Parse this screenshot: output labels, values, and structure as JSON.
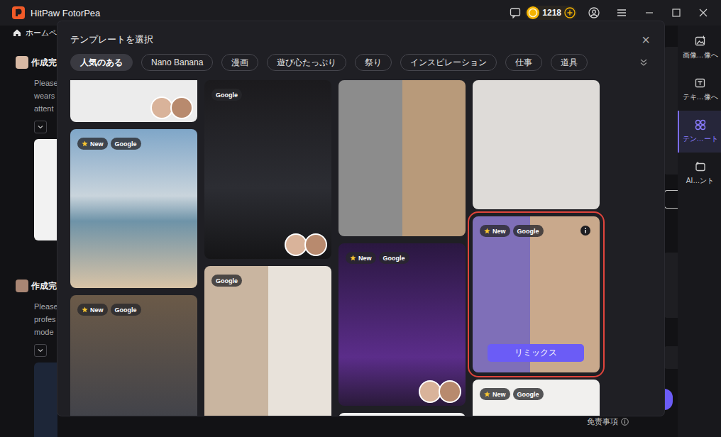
{
  "window": {
    "title": "HitPaw FotorPea"
  },
  "title_bar": {
    "coins": "1218"
  },
  "home": {
    "label": "ホームペ"
  },
  "history": [
    {
      "title": "作成完",
      "lines": [
        "Please",
        "wears",
        "attent"
      ]
    },
    {
      "title": "作成完",
      "lines": [
        "Please",
        "profes",
        "mode"
      ]
    }
  ],
  "sidebar": {
    "items": [
      {
        "label": "画像…像へ",
        "selected": false
      },
      {
        "label": "テキ…像へ",
        "selected": false
      },
      {
        "label": "テン…ート",
        "selected": true
      },
      {
        "label": "AI…ント",
        "selected": false
      }
    ]
  },
  "disclaimer": "免责事項",
  "modal": {
    "title": "テンプレートを選択",
    "close": "×",
    "tabs": [
      {
        "label": "人気のある",
        "selected": true
      },
      {
        "label": "Nano Banana",
        "selected": false
      },
      {
        "label": "漫画",
        "selected": false
      },
      {
        "label": "遊び心たっぷり",
        "selected": false
      },
      {
        "label": "祭り",
        "selected": false
      },
      {
        "label": "インスピレーション",
        "selected": false
      },
      {
        "label": "仕事",
        "selected": false
      },
      {
        "label": "道具",
        "selected": false
      }
    ],
    "columns": [
      [
        {
          "badges": [],
          "avatars": 2,
          "selected": false
        },
        {
          "badges": [
            {
              "label": "New",
              "kind": "new"
            },
            {
              "label": "Google",
              "kind": "source"
            }
          ],
          "avatars": 0,
          "selected": false
        },
        {
          "badges": [
            {
              "label": "New",
              "kind": "new"
            },
            {
              "label": "Google",
              "kind": "source"
            }
          ],
          "avatars": 0,
          "selected": false
        }
      ],
      [
        {
          "badges": [
            {
              "label": "Google",
              "kind": "source"
            }
          ],
          "avatars": 2,
          "selected": false
        },
        {
          "badges": [
            {
              "label": "Google",
              "kind": "source"
            }
          ],
          "avatars": 0,
          "selected": false
        }
      ],
      [
        {
          "badges": [],
          "avatars": 0,
          "selected": false
        },
        {
          "badges": [
            {
              "label": "New",
              "kind": "new"
            },
            {
              "label": "Google",
              "kind": "source"
            }
          ],
          "avatars": 2,
          "selected": false
        },
        {
          "badges": [],
          "avatars": 0,
          "selected": false
        }
      ],
      [
        {
          "badges": [],
          "avatars": 0,
          "selected": false
        },
        {
          "badges": [
            {
              "label": "New",
              "kind": "new"
            },
            {
              "label": "Google",
              "kind": "source"
            }
          ],
          "avatars": 0,
          "selected": true,
          "button": "リミックス"
        },
        {
          "badges": [
            {
              "label": "New",
              "kind": "new"
            },
            {
              "label": "Google",
              "kind": "source"
            }
          ],
          "avatars": 0,
          "selected": false
        }
      ]
    ]
  }
}
